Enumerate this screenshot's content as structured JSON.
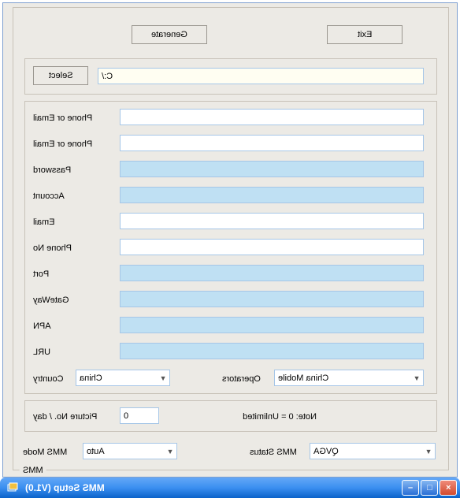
{
  "window": {
    "title": "MMS Setup (V1.0)"
  },
  "group": {
    "legend": "MMS"
  },
  "row1": {
    "mode_label": "MMS Mode",
    "mode_value": "Auto",
    "status_label": "MMS Status",
    "status_value": "QVGA"
  },
  "row2": {
    "pic_label": "Picture No. / day",
    "pic_value": "0",
    "note": "Note: 0 = Unlimited"
  },
  "row3": {
    "country_label": "Country",
    "country_value": "China",
    "operators_label": "Operators",
    "operators_value": "China Mobile"
  },
  "fields": {
    "url": "URL",
    "apn": "APN",
    "gateway": "GateWay",
    "port": "Port",
    "phone": "Phone No",
    "email": "Email",
    "account": "Account",
    "password": "Password",
    "poe1": "Phone or Email",
    "poe2": "Phone or Email"
  },
  "path": {
    "value": "C:/",
    "select_btn": "Select"
  },
  "buttons": {
    "generate": "Generate",
    "exit": "Exit"
  }
}
